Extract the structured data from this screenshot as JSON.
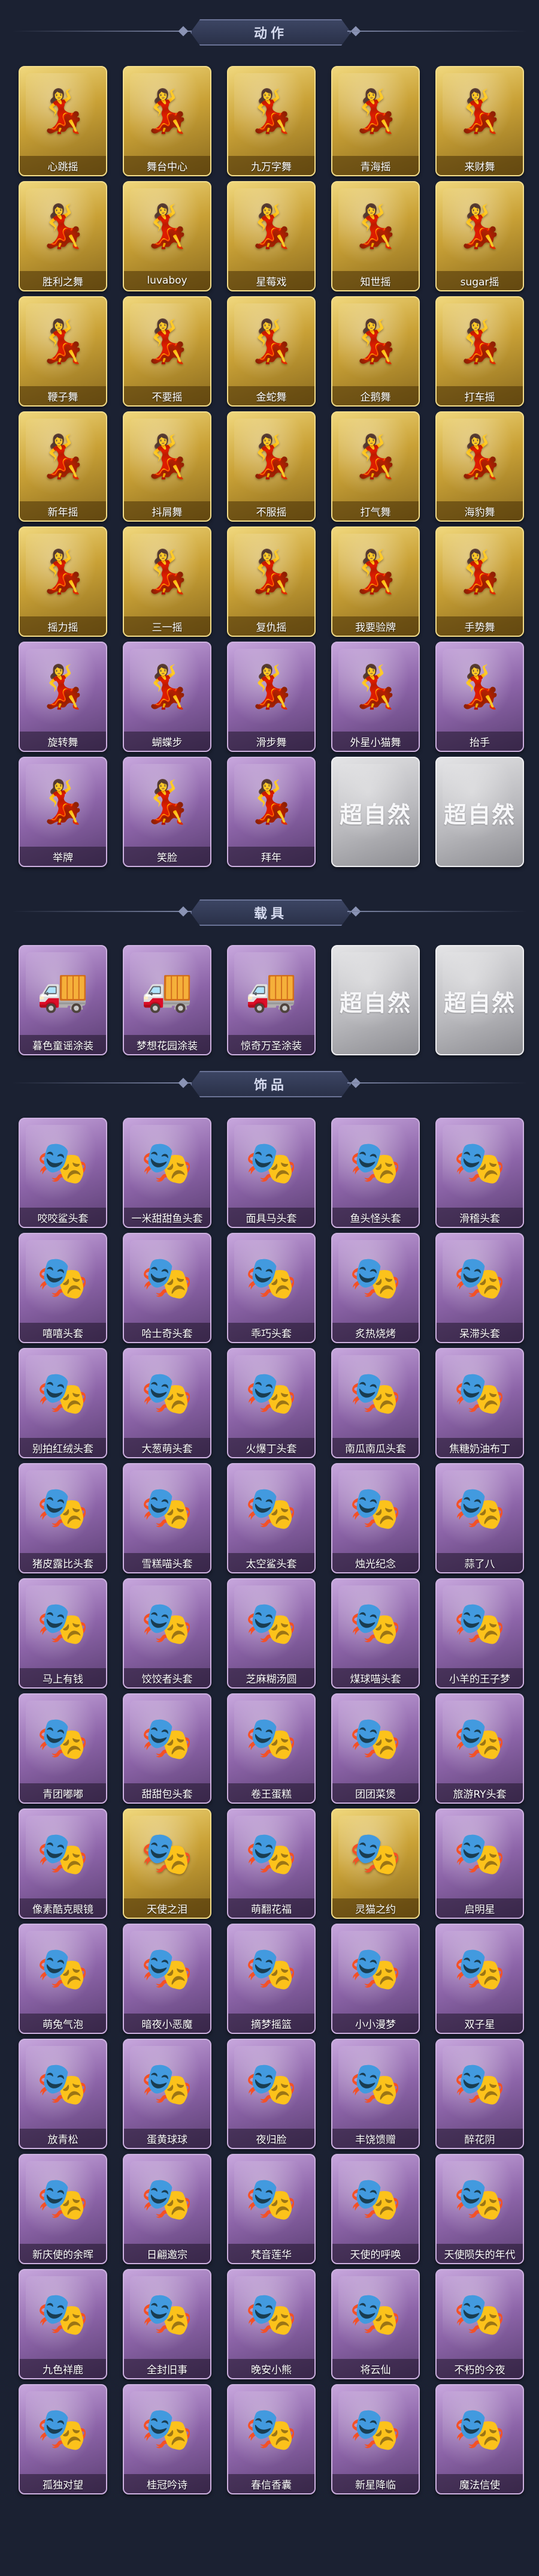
{
  "sections": {
    "actions": {
      "title": "动作",
      "items": [
        {
          "label": "心跳摇",
          "style": "gold",
          "icon": "dance-pose-icon"
        },
        {
          "label": "舞台中心",
          "style": "gold",
          "icon": "dance-pose-icon"
        },
        {
          "label": "九万字舞",
          "style": "gold",
          "icon": "dance-pose-icon"
        },
        {
          "label": "青海摇",
          "style": "gold",
          "icon": "dance-pose-icon"
        },
        {
          "label": "来财舞",
          "style": "gold",
          "icon": "dance-pose-icon"
        },
        {
          "label": "胜利之舞",
          "style": "gold",
          "icon": "dance-pose-icon"
        },
        {
          "label": "luvaboy",
          "style": "gold",
          "icon": "dance-pose-icon"
        },
        {
          "label": "星莓戏",
          "style": "gold",
          "icon": "dance-pose-icon"
        },
        {
          "label": "知世摇",
          "style": "gold",
          "icon": "dance-pose-icon"
        },
        {
          "label": "sugar摇",
          "style": "gold",
          "icon": "dance-pose-icon"
        },
        {
          "label": "鞭子舞",
          "style": "gold",
          "icon": "dance-pose-icon"
        },
        {
          "label": "不要摇",
          "style": "gold",
          "icon": "dance-pose-icon"
        },
        {
          "label": "金蛇舞",
          "style": "gold",
          "icon": "dance-pose-icon"
        },
        {
          "label": "企鹅舞",
          "style": "gold",
          "icon": "dance-pose-icon"
        },
        {
          "label": "打车摇",
          "style": "gold",
          "icon": "dance-pose-icon"
        },
        {
          "label": "新年摇",
          "style": "gold",
          "icon": "dance-pose-icon"
        },
        {
          "label": "抖屑舞",
          "style": "gold",
          "icon": "dance-pose-icon"
        },
        {
          "label": "不服摇",
          "style": "gold",
          "icon": "dance-pose-icon"
        },
        {
          "label": "打气舞",
          "style": "gold",
          "icon": "dance-pose-icon"
        },
        {
          "label": "海豹舞",
          "style": "gold",
          "icon": "dance-pose-icon"
        },
        {
          "label": "摇力摇",
          "style": "gold",
          "icon": "dance-pose-icon"
        },
        {
          "label": "三一摇",
          "style": "gold",
          "icon": "dance-pose-icon"
        },
        {
          "label": "复仇摇",
          "style": "gold",
          "icon": "dance-pose-icon"
        },
        {
          "label": "我要验牌",
          "style": "gold",
          "icon": "dance-pose-icon"
        },
        {
          "label": "手势舞",
          "style": "gold",
          "icon": "dance-pose-icon"
        },
        {
          "label": "旋转舞",
          "style": "purple",
          "icon": "dance-pose-icon"
        },
        {
          "label": "蝴蝶步",
          "style": "purple",
          "icon": "dance-pose-icon"
        },
        {
          "label": "滑步舞",
          "style": "purple",
          "icon": "dance-pose-icon"
        },
        {
          "label": "外星小猫舞",
          "style": "purple",
          "icon": "dance-pose-icon"
        },
        {
          "label": "抬手",
          "style": "purple",
          "icon": "dance-pose-icon"
        },
        {
          "label": "举牌",
          "style": "purple",
          "icon": "dance-pose-icon"
        },
        {
          "label": "笑脸",
          "style": "purple",
          "icon": "dance-pose-icon"
        },
        {
          "label": "拜年",
          "style": "purple",
          "icon": "dance-pose-icon"
        },
        {
          "label": "",
          "style": "silver",
          "icon": "placeholder-logo-icon",
          "logo": "超自然"
        },
        {
          "label": "",
          "style": "silver",
          "icon": "placeholder-logo-icon",
          "logo": "超自然"
        }
      ]
    },
    "vehicles": {
      "title": "载具",
      "items": [
        {
          "label": "暮色童谣涂装",
          "style": "purple",
          "icon": "vehicle-icon"
        },
        {
          "label": "梦想花园涂装",
          "style": "purple",
          "icon": "vehicle-icon"
        },
        {
          "label": "惊奇万圣涂装",
          "style": "purple",
          "icon": "vehicle-icon"
        },
        {
          "label": "",
          "style": "silver",
          "icon": "placeholder-logo-icon",
          "logo": "超自然"
        },
        {
          "label": "",
          "style": "silver",
          "icon": "placeholder-logo-icon",
          "logo": "超自然"
        }
      ]
    },
    "accessories": {
      "title": "饰品",
      "items": [
        {
          "label": "咬咬鲨头套",
          "style": "purple",
          "icon": "headgear-icon"
        },
        {
          "label": "一米甜甜鱼头套",
          "style": "purple",
          "icon": "headgear-icon"
        },
        {
          "label": "面具马头套",
          "style": "purple",
          "icon": "headgear-icon"
        },
        {
          "label": "鱼头怪头套",
          "style": "purple",
          "icon": "headgear-icon"
        },
        {
          "label": "滑稽头套",
          "style": "purple",
          "icon": "headgear-icon"
        },
        {
          "label": "嘻嘻头套",
          "style": "purple",
          "icon": "headgear-icon"
        },
        {
          "label": "哈士奇头套",
          "style": "purple",
          "icon": "headgear-icon"
        },
        {
          "label": "乖巧头套",
          "style": "purple",
          "icon": "headgear-icon"
        },
        {
          "label": "炙热烧烤",
          "style": "purple",
          "icon": "headgear-icon"
        },
        {
          "label": "呆滞头套",
          "style": "purple",
          "icon": "headgear-icon"
        },
        {
          "label": "别拍红绒头套",
          "style": "purple",
          "icon": "headgear-icon"
        },
        {
          "label": "大葱萌头套",
          "style": "purple",
          "icon": "headgear-icon"
        },
        {
          "label": "火爆丁头套",
          "style": "purple",
          "icon": "headgear-icon"
        },
        {
          "label": "南瓜南瓜头套",
          "style": "purple",
          "icon": "headgear-icon"
        },
        {
          "label": "焦糖奶油布丁",
          "style": "purple",
          "icon": "headgear-icon"
        },
        {
          "label": "猪皮露比头套",
          "style": "purple",
          "icon": "headgear-icon"
        },
        {
          "label": "雪糕喵头套",
          "style": "purple",
          "icon": "headgear-icon"
        },
        {
          "label": "太空鲨头套",
          "style": "purple",
          "icon": "headgear-icon"
        },
        {
          "label": "烛光纪念",
          "style": "purple",
          "icon": "headgear-icon"
        },
        {
          "label": "蒜了八",
          "style": "purple",
          "icon": "headgear-icon"
        },
        {
          "label": "马上有钱",
          "style": "purple",
          "icon": "headgear-icon"
        },
        {
          "label": "饺饺者头套",
          "style": "purple",
          "icon": "headgear-icon"
        },
        {
          "label": "芝麻糊汤圆",
          "style": "purple",
          "icon": "headgear-icon"
        },
        {
          "label": "煤球喵头套",
          "style": "purple",
          "icon": "headgear-icon"
        },
        {
          "label": "小羊的王子梦",
          "style": "purple",
          "icon": "headgear-icon"
        },
        {
          "label": "青团嘟嘟",
          "style": "purple",
          "icon": "headgear-icon"
        },
        {
          "label": "甜甜包头套",
          "style": "purple",
          "icon": "headgear-icon"
        },
        {
          "label": "卷王蛋糕",
          "style": "purple",
          "icon": "headgear-icon"
        },
        {
          "label": "团团菜煲",
          "style": "purple",
          "icon": "headgear-icon"
        },
        {
          "label": "旅游RY头套",
          "style": "purple",
          "icon": "headgear-icon"
        },
        {
          "label": "像素酷克眼镜",
          "style": "purple",
          "icon": "headgear-icon"
        },
        {
          "label": "天使之泪",
          "style": "gold",
          "icon": "headgear-icon"
        },
        {
          "label": "萌翻花福",
          "style": "purple",
          "icon": "headgear-icon"
        },
        {
          "label": "灵猫之约",
          "style": "gold",
          "icon": "headgear-icon"
        },
        {
          "label": "启明星",
          "style": "purple",
          "icon": "headgear-icon"
        },
        {
          "label": "萌兔气泡",
          "style": "purple",
          "icon": "headgear-icon"
        },
        {
          "label": "暗夜小恶魔",
          "style": "purple",
          "icon": "headgear-icon"
        },
        {
          "label": "摘梦摇篮",
          "style": "purple",
          "icon": "headgear-icon"
        },
        {
          "label": "小小漫梦",
          "style": "purple",
          "icon": "headgear-icon"
        },
        {
          "label": "双子星",
          "style": "purple",
          "icon": "headgear-icon"
        },
        {
          "label": "放青松",
          "style": "purple",
          "icon": "headgear-icon"
        },
        {
          "label": "蛋黄球球",
          "style": "purple",
          "icon": "headgear-icon"
        },
        {
          "label": "夜归脸",
          "style": "purple",
          "icon": "headgear-icon"
        },
        {
          "label": "丰饶馈赠",
          "style": "purple",
          "icon": "headgear-icon"
        },
        {
          "label": "醉花阴",
          "style": "purple",
          "icon": "headgear-icon"
        },
        {
          "label": "新庆使的余晖",
          "style": "purple",
          "icon": "headgear-icon"
        },
        {
          "label": "日翩邀宗",
          "style": "purple",
          "icon": "headgear-icon"
        },
        {
          "label": "梵音莲华",
          "style": "purple",
          "icon": "headgear-icon"
        },
        {
          "label": "天使的呼唤",
          "style": "purple",
          "icon": "headgear-icon"
        },
        {
          "label": "天使陨失的年代",
          "style": "purple",
          "icon": "headgear-icon"
        },
        {
          "label": "九色祥鹿",
          "style": "purple",
          "icon": "headgear-icon"
        },
        {
          "label": "全封旧事",
          "style": "purple",
          "icon": "headgear-icon"
        },
        {
          "label": "晚安小熊",
          "style": "purple",
          "icon": "headgear-icon"
        },
        {
          "label": "将云仙",
          "style": "purple",
          "icon": "headgear-icon"
        },
        {
          "label": "不朽的今夜",
          "style": "purple",
          "icon": "headgear-icon"
        },
        {
          "label": "孤独对望",
          "style": "purple",
          "icon": "headgear-icon"
        },
        {
          "label": "桂冠吟诗",
          "style": "purple",
          "icon": "headgear-icon"
        },
        {
          "label": "春信香囊",
          "style": "purple",
          "icon": "headgear-icon"
        },
        {
          "label": "新星降临",
          "style": "purple",
          "icon": "headgear-icon"
        },
        {
          "label": "魔法信使",
          "style": "purple",
          "icon": "headgear-icon"
        }
      ]
    }
  },
  "colors": {
    "background": "#1b2132",
    "gold_card": "#c9a136",
    "purple_card": "#8c64a8",
    "silver_card": "#b9b9bd"
  }
}
